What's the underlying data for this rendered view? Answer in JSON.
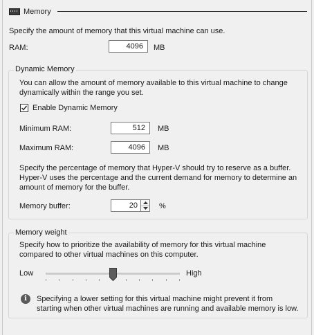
{
  "header": {
    "title": "Memory",
    "icon": "memory-chip-icon"
  },
  "intro": "Specify the amount of memory that this virtual machine can use.",
  "ram": {
    "label": "RAM:",
    "value": "4096",
    "unit": "MB"
  },
  "dynamic_memory": {
    "title": "Dynamic Memory",
    "description_line1": "You can allow the amount of memory available to this virtual machine to change",
    "description_line2": "dynamically within the range you set.",
    "enable_label": "Enable Dynamic Memory",
    "enabled": true,
    "minimum_ram": {
      "label": "Minimum RAM:",
      "value": "512",
      "unit": "MB"
    },
    "maximum_ram": {
      "label": "Maximum RAM:",
      "value": "4096",
      "unit": "MB"
    },
    "buffer_description_line1": "Specify the percentage of memory that Hyper-V should try to reserve as a buffer.",
    "buffer_description_line2": "Hyper-V uses the percentage and the current demand for memory to determine an",
    "buffer_description_line3": "amount of memory for the buffer.",
    "memory_buffer": {
      "label": "Memory buffer:",
      "value": "20",
      "unit": "%"
    }
  },
  "memory_weight": {
    "title": "Memory weight",
    "description_line1": "Specify how to prioritize the availability of memory for this virtual machine",
    "description_line2": "compared to other virtual machines on this computer.",
    "low_label": "Low",
    "high_label": "High",
    "slider_level": 0.5,
    "info_icon": "info-icon",
    "info_line1": "Specifying a lower setting for this virtual machine might prevent it from",
    "info_line2": "starting when other virtual machines are running and available memory is low."
  }
}
